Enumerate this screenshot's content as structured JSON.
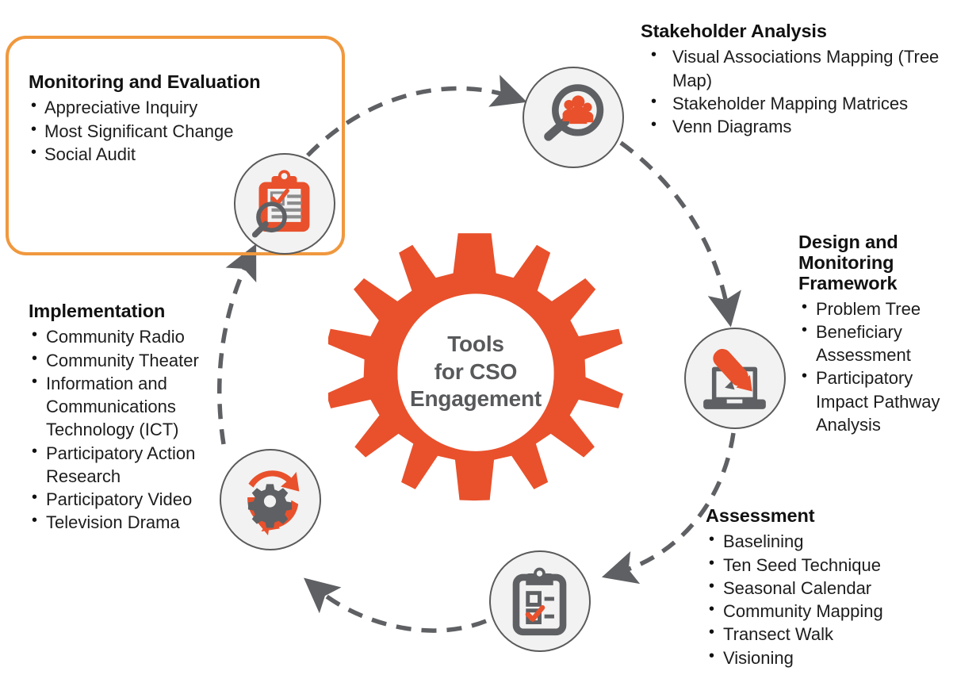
{
  "center": {
    "lines": [
      "Tools",
      "for CSO",
      "Engagement"
    ],
    "shape": "gear",
    "color": "#E8512C"
  },
  "colors": {
    "accent_orange": "#E8512C",
    "highlight_border": "#F0983E",
    "node_fill": "#F2F2F2",
    "node_stroke": "#5A5A5A",
    "arrow_gray": "#5E6063",
    "text_dark": "#1d1d1d",
    "center_text": "#58595B"
  },
  "highlight": {
    "target": "monitoring-and-evaluation",
    "border_color": "#F0983E"
  },
  "nodes": [
    {
      "id": "stakeholder-analysis",
      "icon": "magnifier-people-icon",
      "title": "Stakeholder Analysis",
      "items": [
        "Visual Associations Mapping (Tree Map)",
        "Stakeholder Mapping  Matrices",
        "Venn Diagrams"
      ]
    },
    {
      "id": "design-and-monitoring-framework",
      "icon": "laptop-pencil-icon",
      "title": "Design and Monitoring Framework",
      "items": [
        "Problem Tree",
        "Beneficiary Assessment",
        "Participatory Impact Pathway Analysis"
      ]
    },
    {
      "id": "assessment",
      "icon": "clipboard-checklist-icon",
      "title": "Assessment",
      "items": [
        "Baselining",
        "Ten Seed Technique",
        "Seasonal Calendar",
        "Community Mapping",
        "Transect Walk",
        "Visioning"
      ]
    },
    {
      "id": "implementation",
      "icon": "cycle-gear-icon",
      "title": "Implementation",
      "items": [
        "Community Radio",
        "Community Theater",
        "Information and Communications Technology (ICT)",
        "Participatory Action Research",
        "Participatory Video",
        "Television Drama"
      ]
    },
    {
      "id": "monitoring-and-evaluation",
      "icon": "clipboard-magnifier-icon",
      "title": "Monitoring and Evaluation",
      "items": [
        "Appreciative Inquiry",
        "Most Significant Change",
        "Social Audit"
      ]
    }
  ]
}
